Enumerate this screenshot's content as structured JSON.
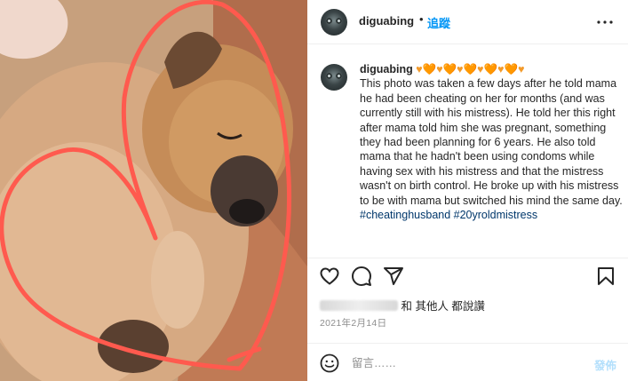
{
  "header": {
    "username": "diguabing",
    "separator": "•",
    "follow_label": "追蹤",
    "more_icon": "more-horizontal-icon"
  },
  "caption": {
    "username": "diguabing",
    "hearts": "♥🧡♥🧡♥🧡♥🧡♥🧡♥",
    "text": "This photo was taken a few days after he told mama he had been cheating on her for months (and was currently still with his mistress). He told her this right after mama told him she was pregnant, something they had been planning for 6 years. He also told mama that he hadn't been using condoms while having sex with his mistress and that the mistress wasn't on birth control. He broke up with his mistress to be with mama but switched his mind the same day.",
    "hashtags": "#cheatinghusband #20yroldmistress"
  },
  "actions": {
    "like_icon": "heart-icon",
    "comment_icon": "comment-icon",
    "share_icon": "send-icon",
    "save_icon": "bookmark-icon"
  },
  "likes": {
    "suffix": "和 其他人 都說讚"
  },
  "date": "2021年2月14日",
  "add_comment": {
    "emoji_icon": "smiley-icon",
    "placeholder": "留言……",
    "post_label": "發佈"
  },
  "colors": {
    "accent": "#0095f6",
    "post_disabled": "#b2dffc",
    "heart_drawing": "#ff5a4e"
  }
}
